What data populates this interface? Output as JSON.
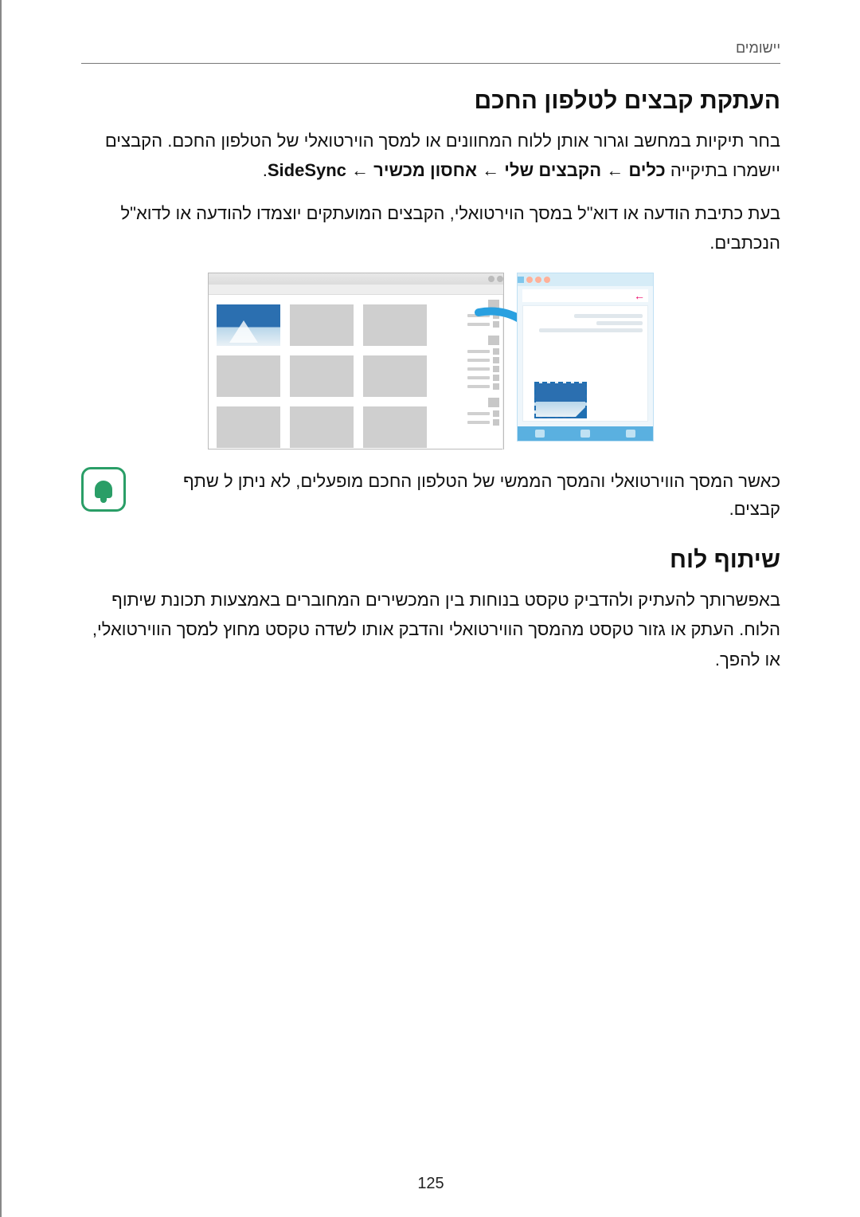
{
  "header": {
    "breadcrumb": "יישומים"
  },
  "section1": {
    "title": "העתקת קבצים לטלפון החכם",
    "p1_a": "בחר תיקיות במחשב וגרור אותן ללוח המחוונים או למסך הוירטואלי של הטלפון החכם. הקבצים יישמרו בתיקייה ",
    "p1_tools": "כלים",
    "p1_arrow1": " ← ",
    "p1_my_files": "הקבצים שלי",
    "p1_arrow2": " ← ",
    "p1_storage": "אחסון מכשיר",
    "p1_arrow3": " ← ",
    "p1_sidesync": "SideSync",
    "p1_period": ".",
    "p2": "בעת כתיבת הודעה או דוא\"ל במסך הוירטואלי, הקבצים המועתקים יוצמדו להודעה או לדוא\"ל הנכתבים."
  },
  "note": {
    "text": "כאשר המסך הווירטואלי והמסך הממשי של הטלפון החכם מופעלים, לא ניתן ל שתף קבצים."
  },
  "section2": {
    "title": "שיתוף לוח",
    "p1": "באפשרותך להעתיק ולהדביק טקסט בנוחות בין המכשירים המחוברים באמצעות תכונת שיתוף הלוח. העתק או גזור טקסט מהמסך הווירטואלי והדבק אותו לשדה טקסט מחוץ למסך הווירטואלי, או להפך."
  },
  "footer": {
    "page": "125"
  }
}
